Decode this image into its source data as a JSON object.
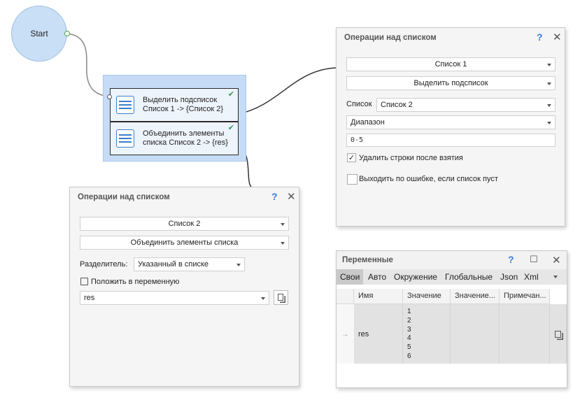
{
  "canvas": {
    "start_label": "Start",
    "actions": [
      {
        "line1": "Выделить подсписок",
        "line2": "Список 1 -> {Список 2}"
      },
      {
        "line1": "Объединить элементы",
        "line2": "списка Список 2 -> {res}"
      }
    ]
  },
  "panel_right": {
    "title": "Операции над списком",
    "help": "?",
    "close": "✕",
    "list_source": "Список 1",
    "operation": "Выделить подсписок",
    "list_label": "Список",
    "list_value": "Список 2",
    "range_mode": "Диапазон",
    "range_value": "0-5",
    "checkbox1_label": "Удалить строки после взятия",
    "checkbox1_mark": "✓",
    "checkbox2_label": "Выходить по ошибке, если список пуст"
  },
  "panel_left": {
    "title": "Операции над списком",
    "help": "?",
    "close": "✕",
    "list_value": "Список 2",
    "operation": "Объединить элементы списка",
    "separator_label": "Разделитель:",
    "separator_value": "Указанный в списке",
    "save_label": "Положить в переменную",
    "var_value": "res"
  },
  "variables": {
    "title": "Переменные",
    "help": "?",
    "maximize": "☐",
    "close": "✕",
    "tabs": [
      "Свои",
      "Авто",
      "Окружение",
      "Глобальные",
      "Json",
      "Xml"
    ],
    "active_tab": "Свои",
    "columns": [
      "Имя",
      "Значение",
      "Значение...",
      "Примечан..."
    ],
    "row_arrow": "→",
    "row": {
      "name": "res",
      "values": [
        "1",
        "2",
        "3",
        "4",
        "5",
        "6"
      ]
    }
  }
}
